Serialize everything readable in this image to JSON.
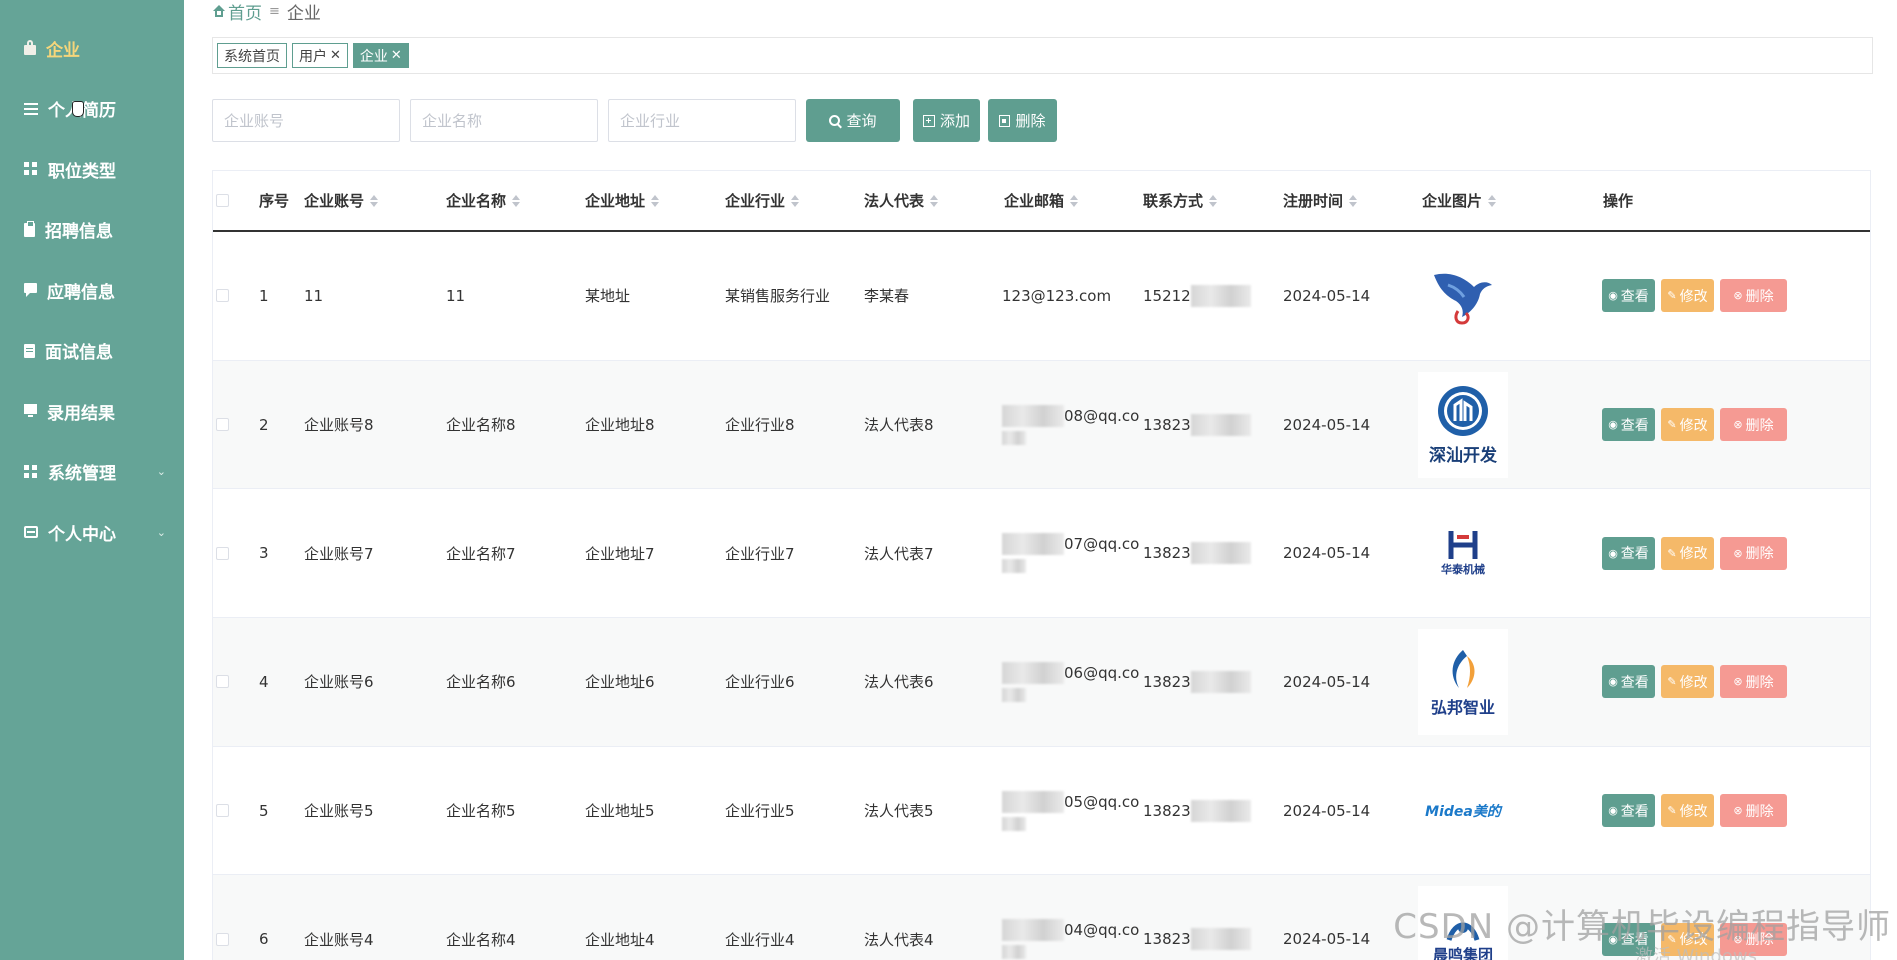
{
  "sidebar": {
    "items": [
      {
        "label": "企业",
        "icon": "lock-icon",
        "highlight": true
      },
      {
        "label": "个人简历",
        "icon": "list-icon"
      },
      {
        "label": "职位类型",
        "icon": "grid-icon"
      },
      {
        "label": "招聘信息",
        "icon": "clipboard-icon"
      },
      {
        "label": "应聘信息",
        "icon": "chat-icon"
      },
      {
        "label": "面试信息",
        "icon": "document-icon"
      },
      {
        "label": "录用结果",
        "icon": "monitor-icon"
      },
      {
        "label": "系统管理",
        "icon": "grid-icon",
        "expandable": true
      },
      {
        "label": "个人中心",
        "icon": "id-card-icon",
        "expandable": true
      }
    ]
  },
  "breadcrumb": {
    "home": "首页",
    "current": "企业"
  },
  "tags": [
    {
      "label": "系统首页",
      "closable": false,
      "active": false
    },
    {
      "label": "用户",
      "closable": true,
      "active": false
    },
    {
      "label": "企业",
      "closable": true,
      "active": true
    }
  ],
  "search": {
    "account_placeholder": "企业账号",
    "name_placeholder": "企业名称",
    "industry_placeholder": "企业行业",
    "query_label": "查询",
    "add_label": "添加",
    "delete_label": "删除"
  },
  "table": {
    "headers": {
      "index": "序号",
      "account": "企业账号",
      "name": "企业名称",
      "address": "企业地址",
      "industry": "企业行业",
      "legal": "法人代表",
      "email": "企业邮箱",
      "phone": "联系方式",
      "reg_time": "注册时间",
      "image": "企业图片",
      "ops": "操作"
    },
    "rows": [
      {
        "index": "1",
        "account": "11",
        "name": "11",
        "address": "某地址",
        "industry": "某销售服务行业",
        "legal": "李某春",
        "email": "123@123.com",
        "email_blurred": false,
        "phone": "15212",
        "reg_time": "2024-05-14",
        "logo": "eagle-logo"
      },
      {
        "index": "2",
        "account": "企业账号8",
        "name": "企业名称8",
        "address": "企业地址8",
        "industry": "企业行业8",
        "legal": "法人代表8",
        "email": "08@qq.co",
        "email_blurred": true,
        "phone": "13823",
        "reg_time": "2024-05-14",
        "logo": "shenshan-logo",
        "logo_text": "深汕开发"
      },
      {
        "index": "3",
        "account": "企业账号7",
        "name": "企业名称7",
        "address": "企业地址7",
        "industry": "企业行业7",
        "legal": "法人代表7",
        "email": "07@qq.co",
        "email_blurred": true,
        "phone": "13823",
        "reg_time": "2024-05-14",
        "logo": "huatai-logo",
        "logo_text": "华泰机械"
      },
      {
        "index": "4",
        "account": "企业账号6",
        "name": "企业名称6",
        "address": "企业地址6",
        "industry": "企业行业6",
        "legal": "法人代表6",
        "email": "06@qq.co",
        "email_blurred": true,
        "phone": "13823",
        "reg_time": "2024-05-14",
        "logo": "hongbang-logo",
        "logo_text": "弘邦智业"
      },
      {
        "index": "5",
        "account": "企业账号5",
        "name": "企业名称5",
        "address": "企业地址5",
        "industry": "企业行业5",
        "legal": "法人代表5",
        "email": "05@qq.co",
        "email_blurred": true,
        "phone": "13823",
        "reg_time": "2024-05-14",
        "logo": "midea-logo",
        "logo_text": "Midea美的"
      },
      {
        "index": "6",
        "account": "企业账号4",
        "name": "企业名称4",
        "address": "企业地址4",
        "industry": "企业行业4",
        "legal": "法人代表4",
        "email": "04@qq.co",
        "email_blurred": true,
        "phone": "13823",
        "reg_time": "2024-05-14",
        "logo": "chenming-logo",
        "logo_text": "晨鸣集团"
      }
    ],
    "actions": {
      "view": "查看",
      "edit": "修改",
      "delete": "删除"
    }
  },
  "watermark": {
    "text": "CSDN @计算机毕设编程指导师",
    "sub": "激活 Windows"
  },
  "colors": {
    "sidebar": "#65a497",
    "primary": "#5f9e90",
    "edit": "#f5b969",
    "delete": "#f59a93",
    "highlight": "#f5d67b"
  }
}
